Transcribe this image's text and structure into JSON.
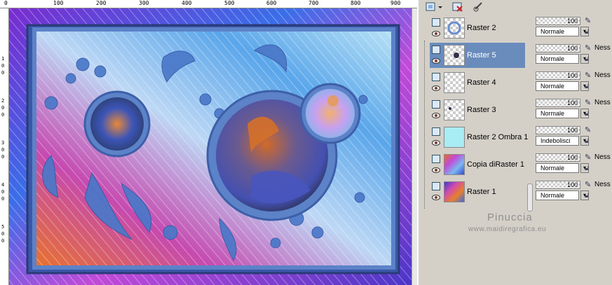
{
  "ruler": {
    "top_labels": [
      "0",
      "100",
      "200",
      "300",
      "400",
      "500",
      "600",
      "700",
      "800",
      "900"
    ],
    "left_labels": [
      "1",
      "0",
      "0",
      "2",
      "0",
      "0",
      "3",
      "0",
      "0",
      "4",
      "0",
      "0",
      "5",
      "0",
      "0"
    ]
  },
  "toolbar": {
    "icons": [
      "new-layer-icon",
      "dropdown-icon",
      "delete-layer-icon",
      "link-icon"
    ]
  },
  "layers": [
    {
      "name": "Raster 2",
      "opacity": "100",
      "blend_mode": "Normale",
      "mask": "",
      "selected": false
    },
    {
      "name": "Raster 5",
      "opacity": "100",
      "blend_mode": "Normale",
      "mask": "Ness",
      "selected": true
    },
    {
      "name": "Raster 4",
      "opacity": "100",
      "blend_mode": "Normale",
      "mask": "Ness",
      "selected": false
    },
    {
      "name": "Raster 3",
      "opacity": "100",
      "blend_mode": "Normale",
      "mask": "Ness",
      "selected": false
    },
    {
      "name": "Raster 2 Ombra 1",
      "opacity": "100",
      "blend_mode": "Indebolisci",
      "mask": "",
      "selected": false
    },
    {
      "name": "Copia diRaster 1",
      "opacity": "100",
      "blend_mode": "Normale",
      "mask": "Ness",
      "selected": false
    },
    {
      "name": "Raster 1",
      "opacity": "100",
      "blend_mode": "Normale",
      "mask": "Ness",
      "selected": false
    }
  ],
  "watermark": {
    "name": "Pinuccia",
    "url": "www.maidiregrafica.eu"
  },
  "colors": {
    "selected_row": "#6a8cbd",
    "frame_blue": "#4a78c8",
    "panel_bg": "#d4d0c8"
  }
}
